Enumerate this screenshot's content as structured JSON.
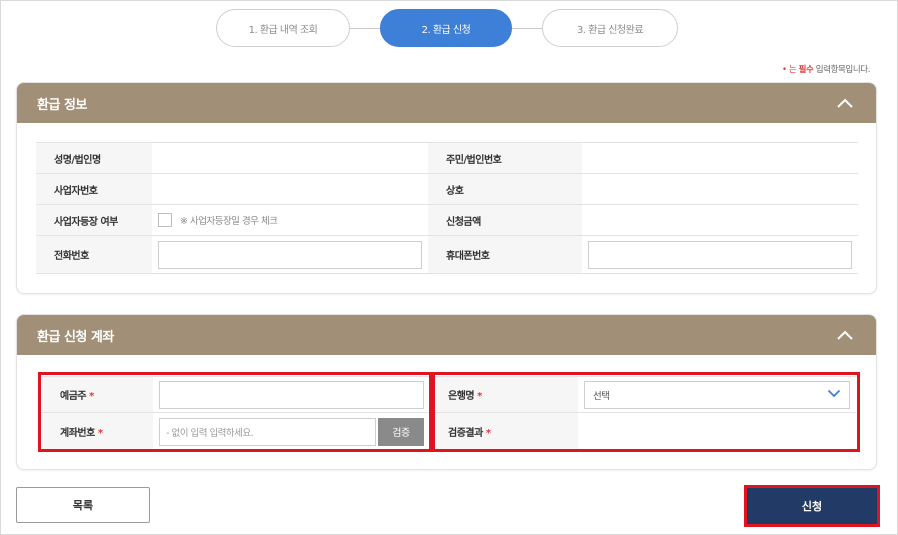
{
  "steps": [
    {
      "label": "1. 환급 내역 조회"
    },
    {
      "label": "2. 환급 신청"
    },
    {
      "label": "3. 환급 신청완료"
    }
  ],
  "required_note": {
    "prefix": "• 는",
    "emphasis": "필수",
    "suffix": "입력항목입니다."
  },
  "refund_info": {
    "title": "환급 정보",
    "rows": [
      {
        "left_label": "성명/법인명",
        "left_value": "",
        "right_label": "주민/법인번호",
        "right_value": ""
      },
      {
        "left_label": "사업자번호",
        "left_value": "",
        "right_label": "상호",
        "right_value": ""
      },
      {
        "left_label": "사업자등장 여부",
        "left_value": "",
        "right_label": "신청금액",
        "right_value": ""
      },
      {
        "left_label": "전화번호",
        "left_value": "",
        "right_label": "휴대폰번호",
        "right_value": ""
      }
    ],
    "business_checkbox_note": "※ 사업자등장일 경우 체크"
  },
  "account": {
    "title": "환급 신청 계좌",
    "depositor_label": "예금주",
    "bank_label": "은행명",
    "bank_selected": "선택",
    "account_label": "계좌번호",
    "account_placeholder": "- 없이 입력 입력하세요.",
    "verify_label": "검증",
    "verify_result_label": "검증결과",
    "required_mark": "*"
  },
  "buttons": {
    "list_label": "목록",
    "apply_label": "신청"
  },
  "colors": {
    "step_active": "#3e7fd8",
    "panel_header": "#a19077",
    "apply_button": "#213a66",
    "highlight": "#e0141e",
    "required": "#e03a3a"
  }
}
